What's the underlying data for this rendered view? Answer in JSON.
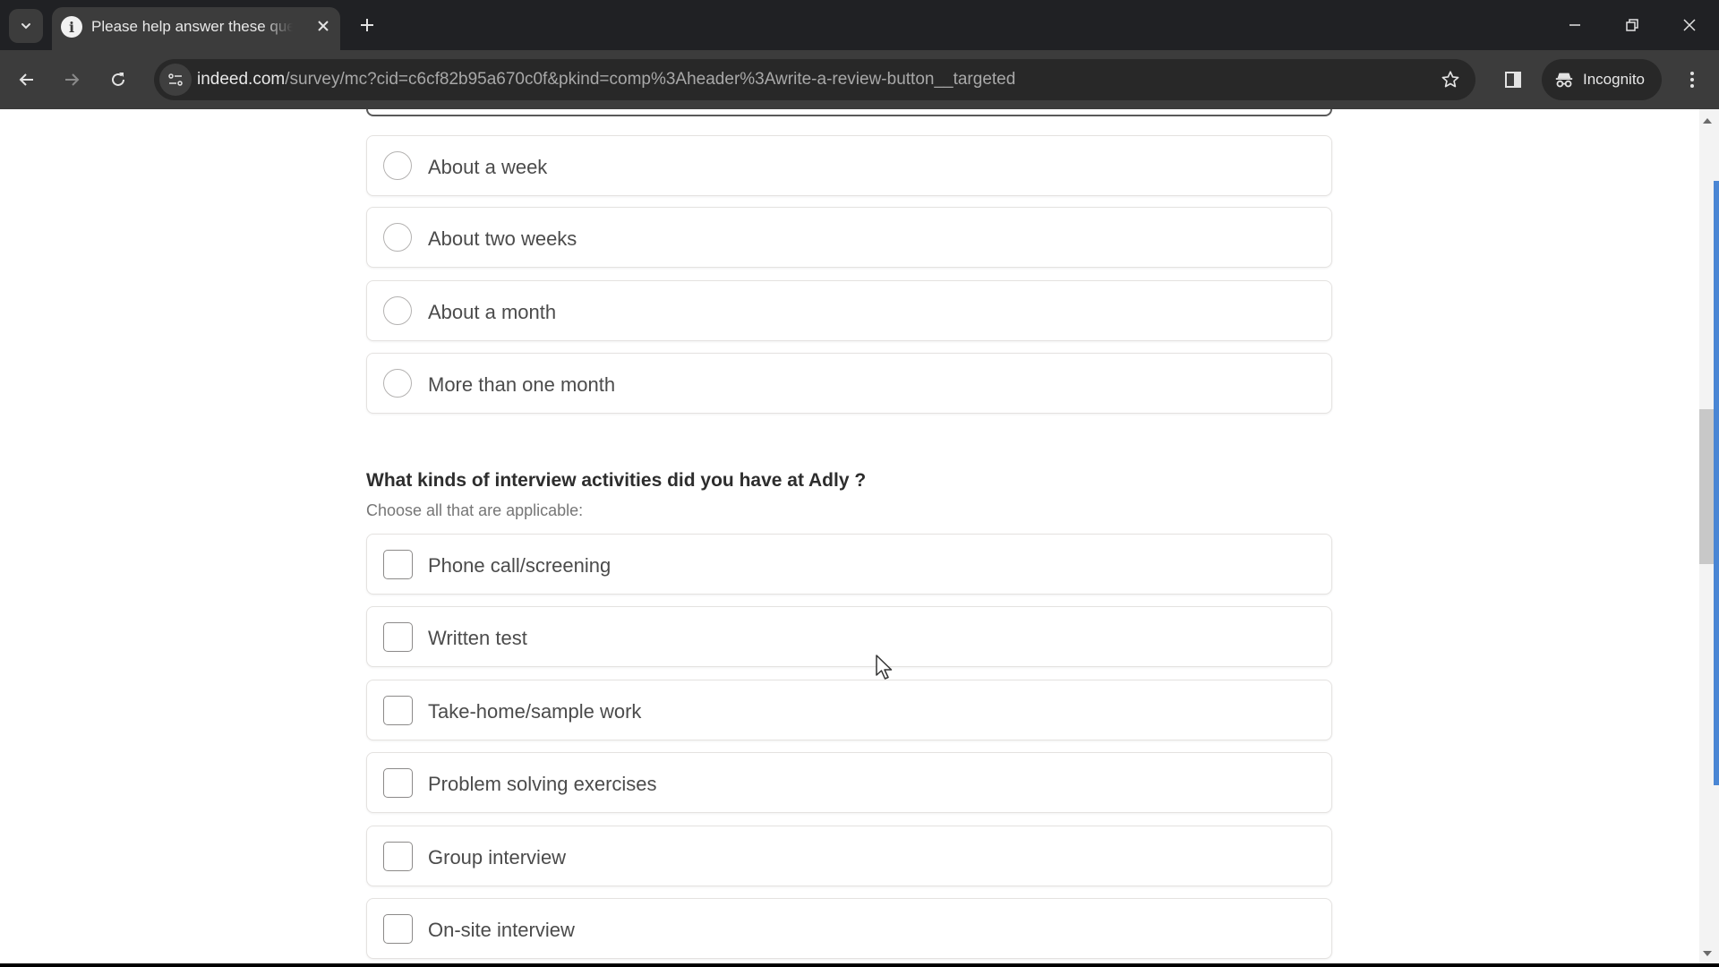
{
  "browser": {
    "tab": {
      "title": "Please help answer these questions",
      "favicon": "info-icon"
    },
    "window_controls": {
      "minimize": "minimize-icon",
      "restore": "restore-icon",
      "close": "close-icon"
    },
    "omnibox": {
      "url_host": "indeed.com",
      "url_path": "/survey/mc?cid=c6cf82b95a670c0f&pkind=comp%3Aheader%3Awrite-a-review-button__targeted"
    },
    "incognito_label": "Incognito"
  },
  "survey": {
    "radio_options": [
      {
        "label": "About a week",
        "selected": false
      },
      {
        "label": "About two weeks",
        "selected": false
      },
      {
        "label": "About a month",
        "selected": false
      },
      {
        "label": "More than one month",
        "selected": false
      }
    ],
    "question": {
      "heading": "What kinds of interview activities did you have at Adly ?",
      "subtitle": "Choose all that are applicable:"
    },
    "checkbox_options": [
      {
        "label": "Phone call/screening",
        "checked": false
      },
      {
        "label": "Written test",
        "checked": false
      },
      {
        "label": "Take-home/sample work",
        "checked": false
      },
      {
        "label": "Problem solving exercises",
        "checked": false
      },
      {
        "label": "Group interview",
        "checked": false
      },
      {
        "label": "On-site interview",
        "checked": false
      }
    ]
  },
  "colors": {
    "tabstrip_bg": "#202124",
    "toolbar_bg": "#3c3c3c",
    "scrollbar_accent": "#4a86d4"
  }
}
